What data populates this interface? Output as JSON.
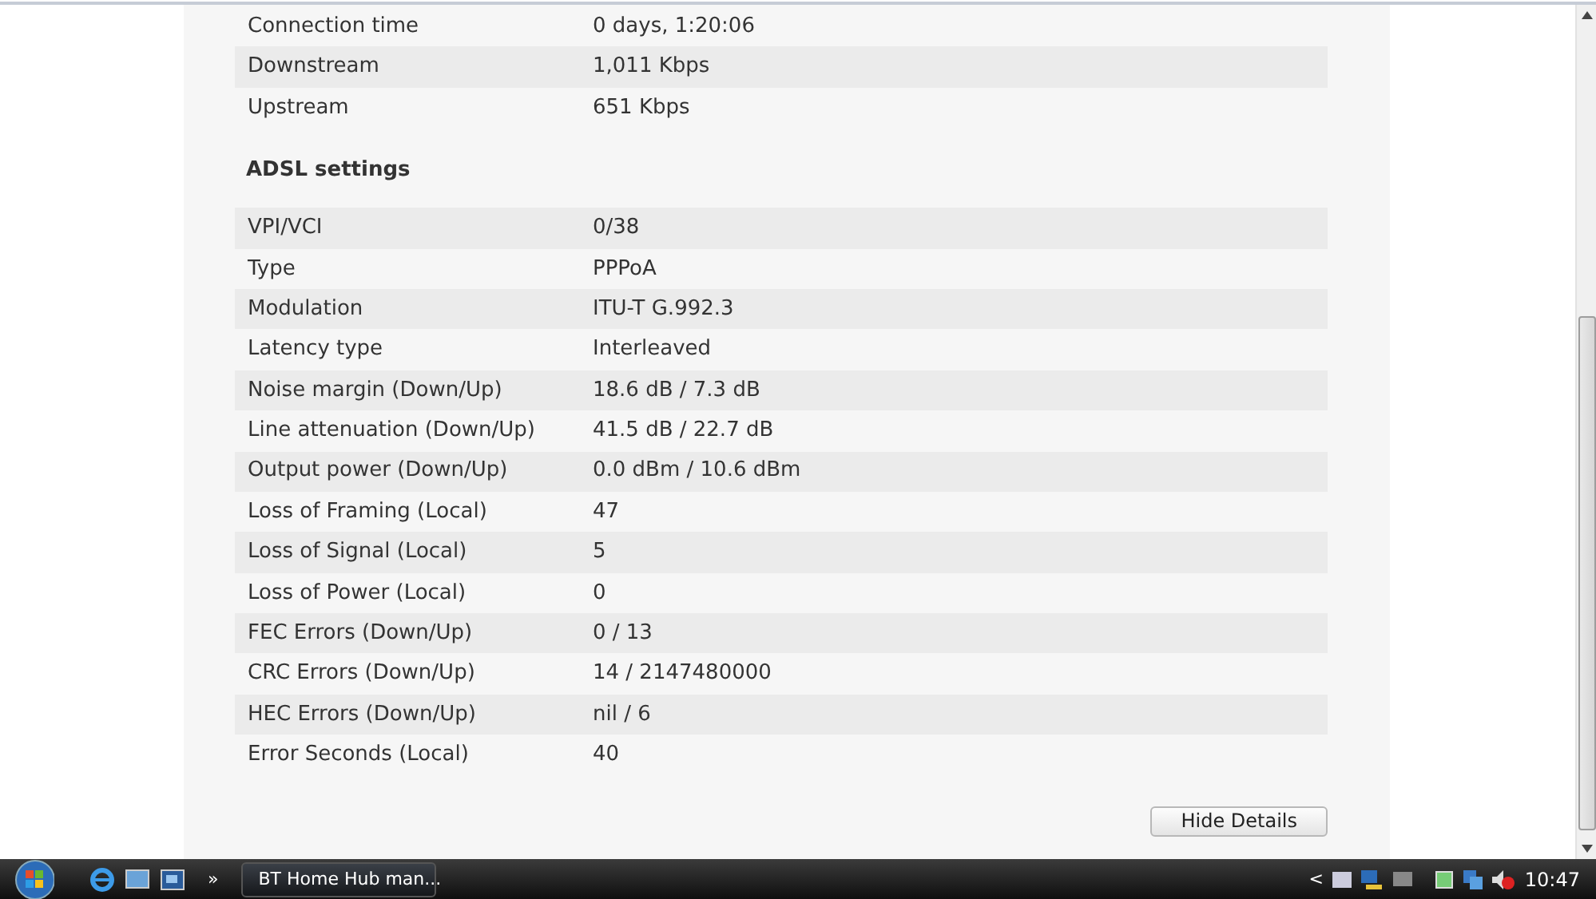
{
  "connection_rows": [
    {
      "label": "Connection time",
      "value": "0 days, 1:20:06"
    },
    {
      "label": "Downstream",
      "value": "1,011 Kbps"
    },
    {
      "label": "Upstream",
      "value": "651 Kbps"
    }
  ],
  "adsl_heading": "ADSL settings",
  "adsl_rows": [
    {
      "label": "VPI/VCI",
      "value": "0/38"
    },
    {
      "label": "Type",
      "value": "PPPoA"
    },
    {
      "label": "Modulation",
      "value": "ITU-T G.992.3"
    },
    {
      "label": "Latency type",
      "value": "Interleaved"
    },
    {
      "label": "Noise margin (Down/Up)",
      "value": "18.6 dB / 7.3 dB"
    },
    {
      "label": "Line attenuation (Down/Up)",
      "value": "41.5 dB / 22.7 dB"
    },
    {
      "label": "Output power (Down/Up)",
      "value": "0.0 dBm / 10.6 dBm"
    },
    {
      "label": "Loss of Framing (Local)",
      "value": "47"
    },
    {
      "label": "Loss of Signal (Local)",
      "value": "5"
    },
    {
      "label": "Loss of Power (Local)",
      "value": "0"
    },
    {
      "label": "FEC Errors (Down/Up)",
      "value": "0 / 13"
    },
    {
      "label": "CRC Errors (Down/Up)",
      "value": "14 / 2147480000"
    },
    {
      "label": "HEC Errors (Down/Up)",
      "value": "nil / 6"
    },
    {
      "label": "Error Seconds (Local)",
      "value": "40"
    }
  ],
  "button": "Hide Details",
  "taskbar": {
    "overflow": "»",
    "task": "BT Home Hub man...",
    "tray_arrow": "<",
    "clock": "10:47"
  }
}
